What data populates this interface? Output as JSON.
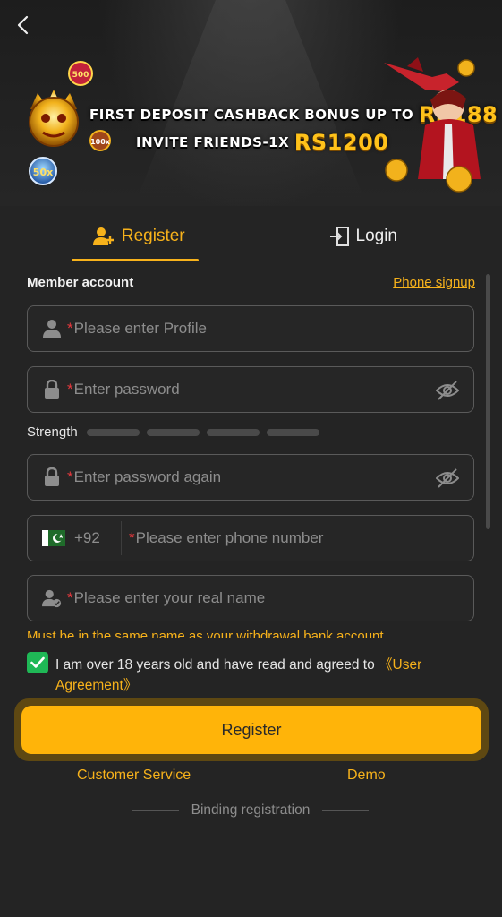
{
  "banner": {
    "line1_text": "FIRST DEPOSIT CASHBACK BONUS UP TO",
    "line1_amount": "RS188",
    "line2_text": "INVITE FRIENDS-1X",
    "line2_amount": "RS1200"
  },
  "tabs": [
    {
      "label": "Register",
      "icon": "add-user-icon",
      "active": true
    },
    {
      "label": "Login",
      "icon": "login-icon",
      "active": false
    }
  ],
  "form": {
    "section_label": "Member account",
    "phone_signup": "Phone signup",
    "required_mark": "*",
    "profile_placeholder": "Please enter Profile",
    "password_placeholder": "Enter password",
    "strength_label": "Strength",
    "password_again_placeholder": "Enter password again",
    "country_code": "+92",
    "phone_placeholder": "Please enter phone number",
    "realname_placeholder": "Please enter your real name",
    "realname_hint": "Must be in the same name as your withdrawal bank account"
  },
  "agreement": {
    "checked": true,
    "text": "I am over 18 years old and have read and agreed to ",
    "link": "《User Agreement》"
  },
  "actions": {
    "register": "Register",
    "customer_service": "Customer Service",
    "demo": "Demo",
    "binding": "Binding registration"
  },
  "colors": {
    "accent": "#f7b21b",
    "background": "#242424",
    "checkbox": "#1fb856",
    "required": "#e8383d"
  }
}
